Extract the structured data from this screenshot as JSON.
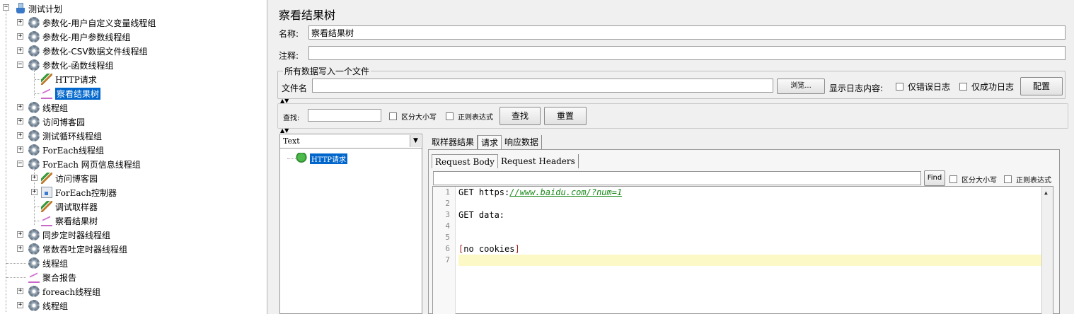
{
  "tree": {
    "root": "测试计划",
    "items": [
      {
        "label": "参数化-用户自定义变量线程组",
        "icon": "gear-icon"
      },
      {
        "label": "参数化-用户参数线程组",
        "icon": "gear-icon"
      },
      {
        "label": "参数化-CSV数据文件线程组",
        "icon": "gear-icon"
      },
      {
        "label": "参数化-函数线程组",
        "icon": "gear-icon"
      },
      {
        "label": "HTTP请求",
        "icon": "http-sampler-icon"
      },
      {
        "label": "察看结果树",
        "icon": "listener-icon"
      },
      {
        "label": "线程组",
        "icon": "gear-icon"
      },
      {
        "label": "访问博客园",
        "icon": "gear-icon"
      },
      {
        "label": "测试循环线程组",
        "icon": "gear-icon"
      },
      {
        "label": "ForEach线程组",
        "icon": "gear-icon"
      },
      {
        "label": "ForEach 网页信息线程组",
        "icon": "gear-icon"
      },
      {
        "label": "访问博客园",
        "icon": "http-sampler-icon"
      },
      {
        "label": "ForEach控制器",
        "icon": "controller-icon"
      },
      {
        "label": "调试取样器",
        "icon": "sampler-icon"
      },
      {
        "label": "察看结果树",
        "icon": "listener-icon"
      },
      {
        "label": "同步定时器线程组",
        "icon": "gear-icon"
      },
      {
        "label": "常数吞吐定时器线程组",
        "icon": "gear-icon"
      },
      {
        "label": "线程组",
        "icon": "gear-icon"
      },
      {
        "label": "聚合报告",
        "icon": "listener-icon"
      },
      {
        "label": "foreach线程组",
        "icon": "gear-icon"
      },
      {
        "label": "线程组",
        "icon": "gear-icon"
      }
    ]
  },
  "panel": {
    "title": "察看结果树",
    "name_label": "名称:",
    "name_value": "察看结果树",
    "comment_label": "注释:",
    "comment_value": "",
    "file_group": "所有数据写入一个文件",
    "file_label": "文件名",
    "file_value": "",
    "browse": "浏览...",
    "log_label": "显示日志内容:",
    "errors_only": "仅错误日志",
    "success_only": "仅成功日志",
    "configure": "配置"
  },
  "search": {
    "label": "查找:",
    "value": "",
    "case": "区分大小写",
    "regex": "正则表达式",
    "find": "查找",
    "reset": "重置"
  },
  "results": {
    "renderer": "Text",
    "sample": "HTTP请求",
    "tabs": [
      "取样器结果",
      "请求",
      "响应数据"
    ],
    "subtabs": [
      "Request Body",
      "Request Headers"
    ],
    "find_button": "Find",
    "case": "区分大小写",
    "regex": "正则表达式",
    "lines": [
      "1",
      "2",
      "3",
      "4",
      "5",
      "6",
      "7"
    ],
    "code": {
      "l1_prefix": "GET https:",
      "l1_url": "//www.baidu.com/?num=1",
      "l3": "GET data:",
      "l6_open": "[",
      "l6_text": "no cookies",
      "l6_close": "]"
    }
  }
}
